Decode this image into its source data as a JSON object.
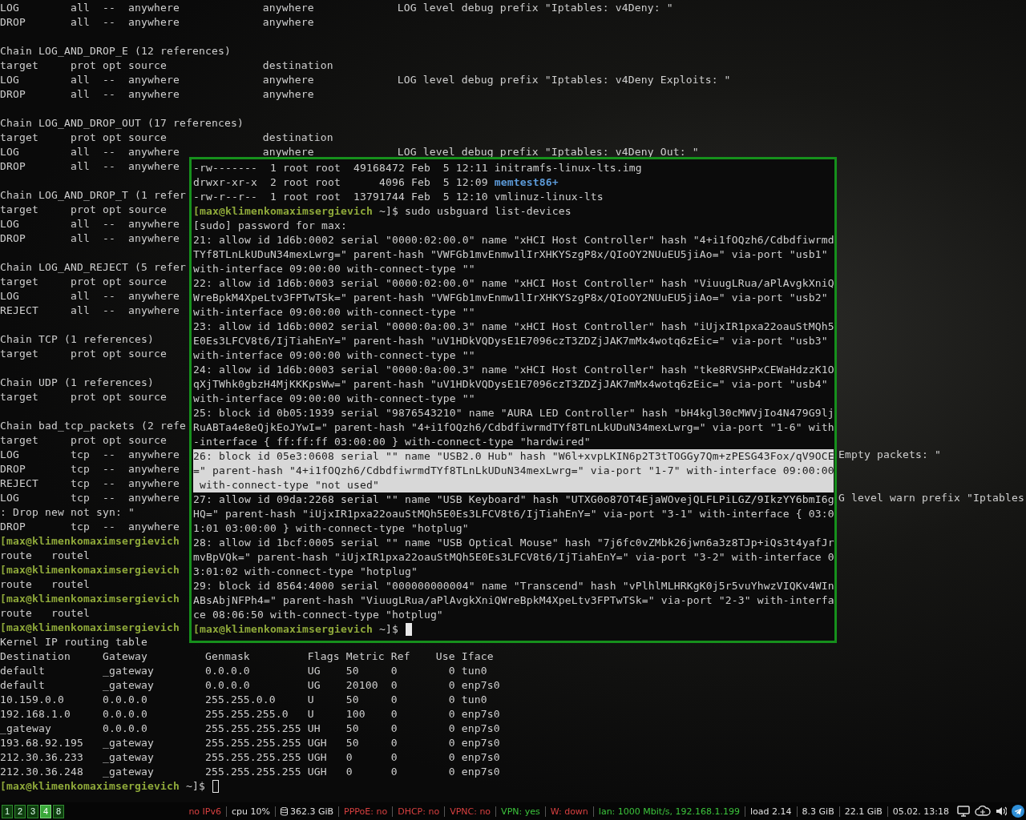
{
  "terminal": {
    "lines": [
      {
        "kind": "output",
        "text": "LOG        all  --  anywhere             anywhere             LOG level debug prefix \"Iptables: v4Deny: \""
      },
      {
        "kind": "output",
        "text": "DROP       all  --  anywhere             anywhere"
      },
      {
        "kind": "blank"
      },
      {
        "kind": "output",
        "text": "Chain LOG_AND_DROP_E (12 references)"
      },
      {
        "kind": "output",
        "text": "target     prot opt source               destination"
      },
      {
        "kind": "output",
        "text": "LOG        all  --  anywhere             anywhere             LOG level debug prefix \"Iptables: v4Deny Exploits: \""
      },
      {
        "kind": "output",
        "text": "DROP       all  --  anywhere             anywhere"
      },
      {
        "kind": "blank"
      },
      {
        "kind": "output",
        "text": "Chain LOG_AND_DROP_OUT (17 references)"
      },
      {
        "kind": "output",
        "text": "target     prot opt source               destination"
      },
      {
        "kind": "output",
        "text": "LOG        all  --  anywhere             anywhere             LOG level debug prefix \"Iptables: v4Deny Out: \""
      },
      {
        "kind": "output",
        "text": "DROP       all  --  anywhere"
      },
      {
        "kind": "blank"
      },
      {
        "kind": "output",
        "text": "Chain LOG_AND_DROP_T (1 refer"
      },
      {
        "kind": "output",
        "text": "target     prot opt source"
      },
      {
        "kind": "output",
        "text": "LOG        all  --  anywhere"
      },
      {
        "kind": "output",
        "text": "DROP       all  --  anywhere"
      },
      {
        "kind": "blank"
      },
      {
        "kind": "output",
        "text": "Chain LOG_AND_REJECT (5 refer"
      },
      {
        "kind": "output",
        "text": "target     prot opt source"
      },
      {
        "kind": "output",
        "text": "LOG        all  --  anywhere"
      },
      {
        "kind": "output",
        "text": "REJECT     all  --  anywhere"
      },
      {
        "kind": "blank"
      },
      {
        "kind": "output",
        "text": "Chain TCP (1 references)"
      },
      {
        "kind": "output",
        "text": "target     prot opt source"
      },
      {
        "kind": "blank"
      },
      {
        "kind": "output",
        "text": "Chain UDP (1 references)"
      },
      {
        "kind": "output",
        "text": "target     prot opt source"
      },
      {
        "kind": "blank"
      },
      {
        "kind": "output",
        "text": "Chain bad_tcp_packets (2 refe"
      },
      {
        "kind": "output",
        "text": "target     prot opt source"
      },
      {
        "kind": "output",
        "text": "LOG        tcp  --  anywhere",
        "right": "Empty packets: \""
      },
      {
        "kind": "output",
        "text": "DROP       tcp  --  anywhere"
      },
      {
        "kind": "output",
        "text": "REJECT     tcp  --  anywhere"
      },
      {
        "kind": "output",
        "text": "LOG        tcp  --  anywhere",
        "right": "G level warn prefix \"Iptables"
      },
      {
        "kind": "output",
        "text": ": Drop new not syn: \""
      },
      {
        "kind": "output",
        "text": "DROP       tcp  --  anywhere"
      },
      {
        "kind": "prompt",
        "host": "[max@klimenkomaximsergievich"
      },
      {
        "kind": "output",
        "text": "route   routel"
      },
      {
        "kind": "prompt",
        "host": "[max@klimenkomaximsergievich"
      },
      {
        "kind": "output",
        "text": "route   routel"
      },
      {
        "kind": "prompt",
        "host": "[max@klimenkomaximsergievich"
      },
      {
        "kind": "output",
        "text": "route   routel"
      },
      {
        "kind": "prompt",
        "host": "[max@klimenkomaximsergievich"
      },
      {
        "kind": "output",
        "text": "Kernel IP routing table"
      },
      {
        "kind": "output",
        "text": "Destination     Gateway         Genmask         Flags Metric Ref    Use Iface"
      },
      {
        "kind": "output",
        "text": "default         _gateway        0.0.0.0         UG    50     0        0 tun0"
      },
      {
        "kind": "output",
        "text": "default         _gateway        0.0.0.0         UG    20100  0        0 enp7s0"
      },
      {
        "kind": "output",
        "text": "10.159.0.0      0.0.0.0         255.255.0.0     U     50     0        0 tun0"
      },
      {
        "kind": "output",
        "text": "192.168.1.0     0.0.0.0         255.255.255.0   U     100    0        0 enp7s0"
      },
      {
        "kind": "output",
        "text": "_gateway        0.0.0.0         255.255.255.255 UH    50     0        0 enp7s0"
      },
      {
        "kind": "output",
        "text": "193.68.92.195   _gateway        255.255.255.255 UGH   50     0        0 enp7s0"
      },
      {
        "kind": "output",
        "text": "212.30.36.233   _gateway        255.255.255.255 UGH   0      0        0 enp7s0"
      },
      {
        "kind": "output",
        "text": "212.30.36.248   _gateway        255.255.255.255 UGH   0      0        0 enp7s0"
      },
      {
        "kind": "prompt",
        "host": "[max@klimenkomaximsergievich",
        "path": "~]$",
        "cursor": true,
        "focused": false
      }
    ]
  },
  "overlay": {
    "lines": [
      {
        "kind": "file",
        "text": "-rw-------  1 root root  49168472 Feb  5 12:11 ",
        "file": "initramfs-linux-lts.img",
        "directory": false
      },
      {
        "kind": "file",
        "text": "drwxr-xr-x  2 root root      4096 Feb  5 12:09 ",
        "file": "memtest86+",
        "directory": true
      },
      {
        "kind": "file",
        "text": "-rw-r--r--  1 root root  13791744 Feb  5 12:10 ",
        "file": "vmlinuz-linux-lts",
        "directory": false
      },
      {
        "kind": "prompt",
        "host": "[max@klimenkomaximsergievich",
        "path": "~]$",
        "command": "sudo usbguard list-devices"
      },
      {
        "kind": "output",
        "text": "[sudo] password for max:"
      },
      {
        "kind": "output",
        "text": "21: allow id 1d6b:0002 serial \"0000:02:00.0\" name \"xHCI Host Controller\" hash \"4+i1fOQzh6/Cdbdfiwrmd"
      },
      {
        "kind": "output",
        "text": "TYf8TLnLkUDuN34mexLwrg=\" parent-hash \"VWFGb1mvEnmw1lIrXHKYSzgP8x/QIoOY2NUuEU5jiAo=\" via-port \"usb1\""
      },
      {
        "kind": "output",
        "text": "with-interface 09:00:00 with-connect-type \"\""
      },
      {
        "kind": "output",
        "text": "22: allow id 1d6b:0003 serial \"0000:02:00.0\" name \"xHCI Host Controller\" hash \"ViuugLRua/aPlAvgkXniQ"
      },
      {
        "kind": "output",
        "text": "WreBpkM4XpeLtv3FPTwTSk=\" parent-hash \"VWFGb1mvEnmw1lIrXHKYSzgP8x/QIoOY2NUuEU5jiAo=\" via-port \"usb2\""
      },
      {
        "kind": "output",
        "text": "with-interface 09:00:00 with-connect-type \"\""
      },
      {
        "kind": "output",
        "text": "23: allow id 1d6b:0002 serial \"0000:0a:00.3\" name \"xHCI Host Controller\" hash \"iUjxIR1pxa22oauStMQh5"
      },
      {
        "kind": "output",
        "text": "E0Es3LFCV8t6/IjTiahEnY=\" parent-hash \"uV1HDkVQDysE1E7096czT3ZDZjJAK7mMx4wotq6zEic=\" via-port \"usb3\""
      },
      {
        "kind": "output",
        "text": "with-interface 09:00:00 with-connect-type \"\""
      },
      {
        "kind": "output",
        "text": "24: allow id 1d6b:0003 serial \"0000:0a:00.3\" name \"xHCI Host Controller\" hash \"tke8RVSHPxCEWaHdzzK1O"
      },
      {
        "kind": "output",
        "text": "qXjTWhk0gbzH4MjKKKpsWw=\" parent-hash \"uV1HDkVQDysE1E7096czT3ZDZjJAK7mMx4wotq6zEic=\" via-port \"usb4\""
      },
      {
        "kind": "output",
        "text": "with-interface 09:00:00 with-connect-type \"\""
      },
      {
        "kind": "output",
        "text": "25: block id 0b05:1939 serial \"9876543210\" name \"AURA LED Controller\" hash \"bH4kgl30cMWVjIo4N479G9lj"
      },
      {
        "kind": "output",
        "text": "RuABTa4e8eQjkEoJYwI=\" parent-hash \"4+i1fOQzh6/CdbdfiwrmdTYf8TLnLkUDuN34mexLwrg=\" via-port \"1-6\" with"
      },
      {
        "kind": "output",
        "text": "-interface { ff:ff:ff 03:00:00 } with-connect-type \"hardwired\""
      },
      {
        "kind": "output",
        "text": "26: block id 05e3:0608 serial \"\" name \"USB2.0 Hub\" hash \"W6l+xvpLKIN6p2T3tTOGGy7Qm+zPESG43Fox/qV9OCE",
        "highlighted": true
      },
      {
        "kind": "output",
        "text": "=\" parent-hash \"4+i1fOQzh6/CdbdfiwrmdTYf8TLnLkUDuN34mexLwrg=\" via-port \"1-7\" with-interface 09:00:00",
        "highlighted": true
      },
      {
        "kind": "output",
        "text": " with-connect-type \"not used\"",
        "highlighted": true
      },
      {
        "kind": "output",
        "text": "27: allow id 09da:2268 serial \"\" name \"USB Keyboard\" hash \"UTXG0o87OT4EjaWOvejQLFLPiLGZ/9IkzYY6bmI6g"
      },
      {
        "kind": "output",
        "text": "HQ=\" parent-hash \"iUjxIR1pxa22oauStMQh5E0Es3LFCV8t6/IjTiahEnY=\" via-port \"3-1\" with-interface { 03:0"
      },
      {
        "kind": "output",
        "text": "1:01 03:00:00 } with-connect-type \"hotplug\""
      },
      {
        "kind": "output",
        "text": "28: allow id 1bcf:0005 serial \"\" name \"USB Optical Mouse\" hash \"7j6fc0vZMbk26jwn6a3z8TJp+iQs3t4yafJr"
      },
      {
        "kind": "output",
        "text": "mvBpVQk=\" parent-hash \"iUjxIR1pxa22oauStMQh5E0Es3LFCV8t6/IjTiahEnY=\" via-port \"3-2\" with-interface 0"
      },
      {
        "kind": "output",
        "text": "3:01:02 with-connect-type \"hotplug\""
      },
      {
        "kind": "output",
        "text": "29: block id 8564:4000 serial \"000000000004\" name \"Transcend\" hash \"vPlhlMLHRKgK0j5r5vuYhwzVIQKv4WIn"
      },
      {
        "kind": "output",
        "text": "ABsAbjNFPh4=\" parent-hash \"ViuugLRua/aPlAvgkXniQWreBpkM4XpeLtv3FPTwTSk=\" via-port \"2-3\" with-interfa"
      },
      {
        "kind": "output",
        "text": "ce 08:06:50 with-connect-type \"hotplug\""
      },
      {
        "kind": "prompt",
        "host": "[max@klimenkomaximsergievich",
        "path": "~]$",
        "cursor": true,
        "focused": true
      }
    ]
  },
  "status_bar": {
    "workspaces": [
      {
        "label": "1",
        "selected": false
      },
      {
        "label": "2",
        "selected": false
      },
      {
        "label": "3",
        "selected": false
      },
      {
        "label": "4",
        "selected": true
      },
      {
        "label": "8",
        "selected": false
      }
    ],
    "items": [
      {
        "kind": "text",
        "text": "no IPv6",
        "color": "#d84040"
      },
      {
        "kind": "text",
        "text": "cpu  10%",
        "color": "#e0e0e0"
      },
      {
        "kind": "disk",
        "text": "362.3 GiB",
        "color": "#e0e0e0"
      },
      {
        "kind": "text",
        "text": "PPPoE: no",
        "color": "#d84040"
      },
      {
        "kind": "text",
        "text": "DHCP: no",
        "color": "#d84040"
      },
      {
        "kind": "text",
        "text": "VPNC: no",
        "color": "#d84040"
      },
      {
        "kind": "text",
        "text": "VPN: yes",
        "color": "#3cc43c"
      },
      {
        "kind": "text",
        "text": "W: down",
        "color": "#d84040"
      },
      {
        "kind": "text",
        "text": "lan: 1000 Mbit/s, 192.168.1.199",
        "color": "#3cc43c"
      },
      {
        "kind": "text",
        "text": "load 2.14",
        "color": "#e0e0e0"
      },
      {
        "kind": "text",
        "text": "8.3 GiB",
        "color": "#e0e0e0"
      },
      {
        "kind": "text",
        "text": "22.1 GiB",
        "color": "#e0e0e0"
      },
      {
        "kind": "text",
        "text": "05.02. 13:18",
        "color": "#e0e0e0"
      }
    ]
  }
}
